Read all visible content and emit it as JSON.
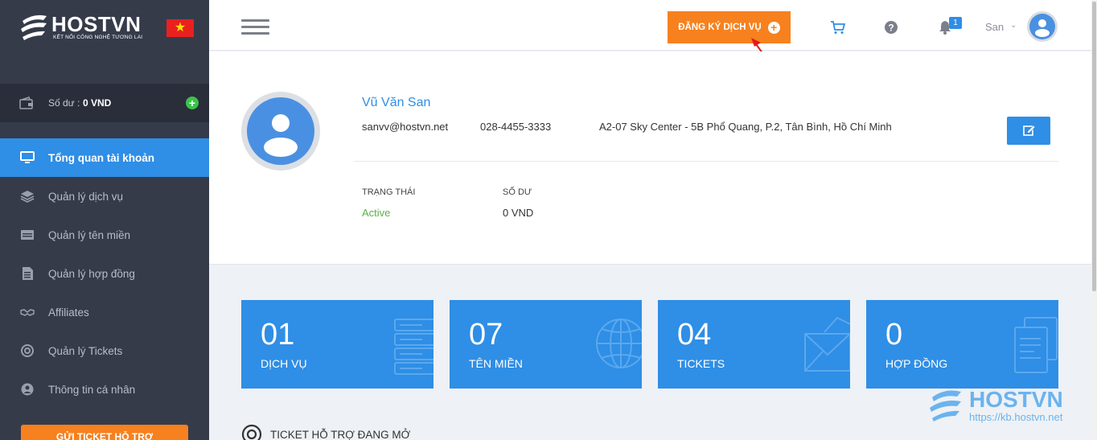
{
  "brand": {
    "name": "HOSTVN",
    "tagline": "KẾT NỐI CÔNG NGHỆ TƯƠNG LAI"
  },
  "sidebar": {
    "balance_label": "Số dư :",
    "balance_value": "0 VND",
    "items": [
      {
        "label": "Tổng quan tài khoản",
        "icon": "monitor-icon",
        "active": true
      },
      {
        "label": "Quản lý dịch vụ",
        "icon": "layers-icon",
        "active": false
      },
      {
        "label": "Quản lý tên miền",
        "icon": "domain-icon",
        "active": false
      },
      {
        "label": "Quản lý hợp đồng",
        "icon": "document-icon",
        "active": false
      },
      {
        "label": "Affiliates",
        "icon": "handshake-icon",
        "active": false
      },
      {
        "label": "Quản lý Tickets",
        "icon": "lifebuoy-icon",
        "active": false
      },
      {
        "label": "Thông tin cá nhân",
        "icon": "user-circle-icon",
        "active": false
      }
    ],
    "support_button": "GỬI TICKET HỖ TRỢ"
  },
  "header": {
    "register_label": "ĐĂNG KÝ DỊCH VỤ",
    "notification_count": "1",
    "user_name": "San"
  },
  "profile": {
    "name": "Vũ Văn San",
    "email": "sanvv@hostvn.net",
    "phone": "028-4455-3333",
    "address": "A2-07 Sky Center - 5B Phổ Quang, P.2, Tân Bình, Hồ Chí Minh",
    "status_label": "TRẠNG THÁI",
    "status_value": "Active",
    "balance_label": "SỐ DƯ",
    "balance_value": "0 VND"
  },
  "cards": [
    {
      "number": "01",
      "label": "DỊCH VỤ",
      "icon": "server-icon"
    },
    {
      "number": "07",
      "label": "TÊN MIỀN",
      "icon": "globe-icon"
    },
    {
      "number": "04",
      "label": "TICKETS",
      "icon": "envelope-icon"
    },
    {
      "number": "0",
      "label": "HỢP ĐỒNG",
      "icon": "contract-icon"
    }
  ],
  "open_tickets_title": "TICKET HỖ TRỢ ĐANG MỞ",
  "watermark": {
    "name": "HOSTVN",
    "url": "https://kb.hostvn.net"
  },
  "colors": {
    "sidebar_bg": "#363b4a",
    "accent_blue": "#2f8ee5",
    "accent_orange": "#f7811e",
    "status_green": "#5bb042"
  }
}
